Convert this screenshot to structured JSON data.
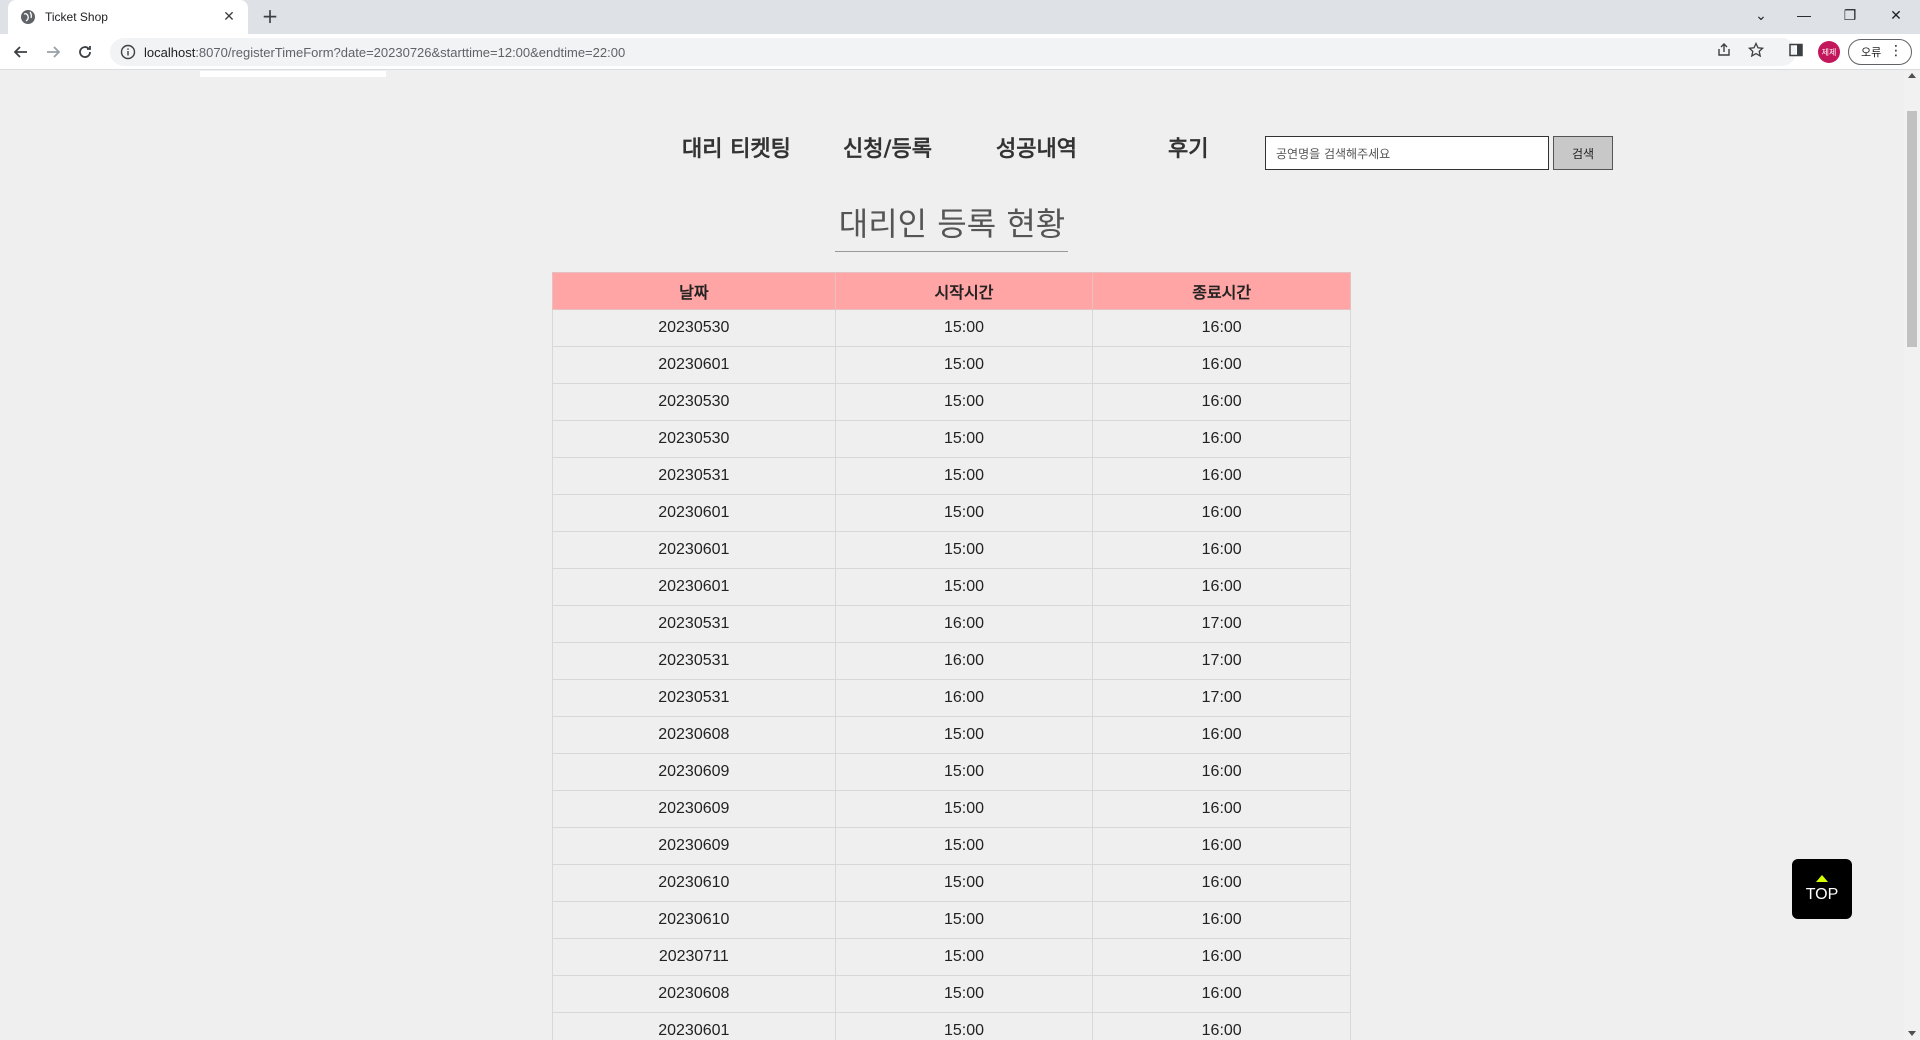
{
  "browser": {
    "tab_title": "Ticket Shop",
    "tab_close": "✕",
    "new_tab": "+",
    "url_host": "localhost",
    "url_rest": ":8070/registerTimeForm?date=20230726&starttime=12:00&endtime=22:00",
    "profile_initials": "제제",
    "error_label": "오류",
    "menu_dots": "⋮",
    "window_controls": {
      "dropdown": "⌄",
      "minimize": "—",
      "restore": "❐",
      "close": "✕"
    }
  },
  "nav": {
    "items": [
      "대리 티켓팅",
      "신청/등록",
      "성공내역",
      "후기"
    ],
    "search_placeholder": "공연명을 검색해주세요",
    "search_button": "검색"
  },
  "page_title": "대리인 등록 현황",
  "table": {
    "headers": [
      "날짜",
      "시작시간",
      "종료시간"
    ],
    "rows": [
      [
        "20230530",
        "15:00",
        "16:00"
      ],
      [
        "20230601",
        "15:00",
        "16:00"
      ],
      [
        "20230530",
        "15:00",
        "16:00"
      ],
      [
        "20230530",
        "15:00",
        "16:00"
      ],
      [
        "20230531",
        "15:00",
        "16:00"
      ],
      [
        "20230601",
        "15:00",
        "16:00"
      ],
      [
        "20230601",
        "15:00",
        "16:00"
      ],
      [
        "20230601",
        "15:00",
        "16:00"
      ],
      [
        "20230531",
        "16:00",
        "17:00"
      ],
      [
        "20230531",
        "16:00",
        "17:00"
      ],
      [
        "20230531",
        "16:00",
        "17:00"
      ],
      [
        "20230608",
        "15:00",
        "16:00"
      ],
      [
        "20230609",
        "15:00",
        "16:00"
      ],
      [
        "20230609",
        "15:00",
        "16:00"
      ],
      [
        "20230609",
        "15:00",
        "16:00"
      ],
      [
        "20230610",
        "15:00",
        "16:00"
      ],
      [
        "20230610",
        "15:00",
        "16:00"
      ],
      [
        "20230711",
        "15:00",
        "16:00"
      ],
      [
        "20230608",
        "15:00",
        "16:00"
      ],
      [
        "20230601",
        "15:00",
        "16:00"
      ]
    ]
  },
  "top_button": "TOP",
  "colors": {
    "header_bg": "#ffa5a5",
    "page_bg": "#efefef",
    "top_arrow": "#d4ff00",
    "profile": "#c2185b"
  }
}
